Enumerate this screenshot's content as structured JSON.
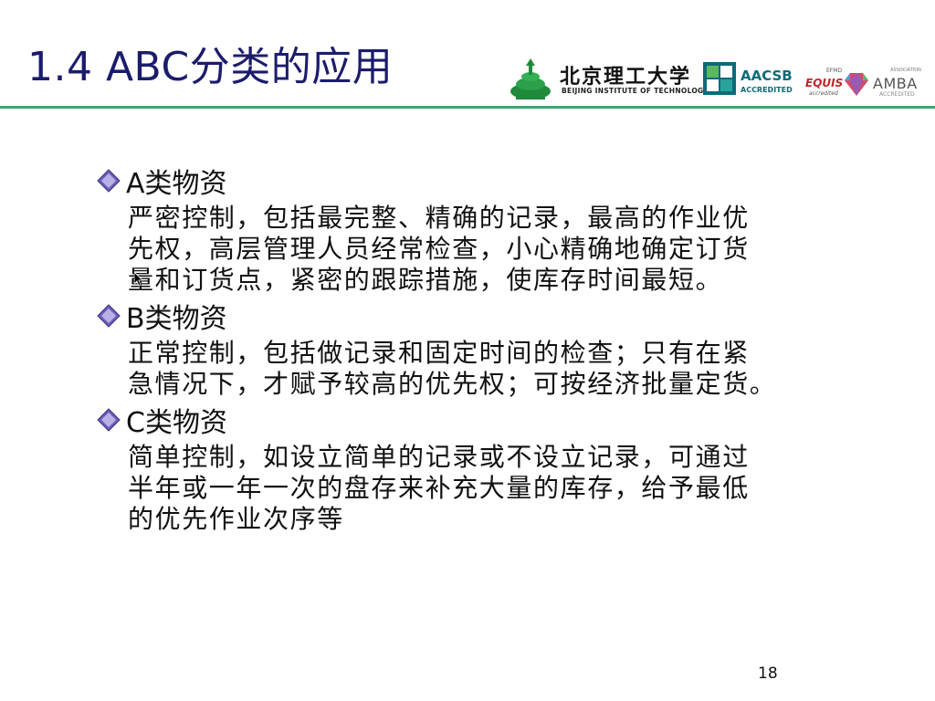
{
  "title": "1.4 ABC分类的应用",
  "logos": {
    "bit_cn": "北京理工大学",
    "bit_en": "BEIJING INSTITUTE OF TECHNOLOGY",
    "aacsb_name": "AACSB",
    "aacsb_sub": "ACCREDITED",
    "efmd": "EFMD",
    "equis": "EQUIS",
    "equis_sub": "accredited",
    "amba_assoc": "ASSOCIATION",
    "amba_name": "AMBA",
    "amba_sub": "ACCREDITED"
  },
  "sections": [
    {
      "heading": "A类物资",
      "lines": [
        "严密控制，包括最完整、精确的记录，最高的作业优",
        "先权，高层管理人员经常检查，小心精确地确定订货",
        "量和订货点，紧密的跟踪措施，使库存时间最短。"
      ]
    },
    {
      "heading": "B类物资",
      "lines": [
        "正常控制，包括做记录和固定时间的检查；只有在紧",
        "急情况下，才赋予较高的优先权；可按经济批量定货。"
      ]
    },
    {
      "heading": "C类物资",
      "lines": [
        "简单控制，如设立简单的记录或不设立记录，可通过",
        "半年或一年一次的盘存来补充大量的库存，给予最低",
        "的优先作业次序等"
      ]
    }
  ],
  "page_number": "18",
  "colors": {
    "title": "#1c1c6c",
    "rule": "#3aa876",
    "bullet": "#4b3f9a"
  }
}
